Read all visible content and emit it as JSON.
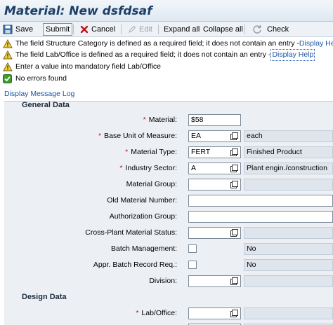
{
  "window": {
    "title": "Material: New dsfdsaf"
  },
  "toolbar": {
    "save_label": "Save",
    "submit_label": "Submit",
    "cancel_label": "Cancel",
    "edit_label": "Edit",
    "expand_all_label": "Expand all",
    "collapse_all_label": "Collapse all",
    "check_label": "Check"
  },
  "messages": [
    {
      "type": "warning",
      "text": "The field Structure Category is defined as a required field; it does not contain an entry - ",
      "link": "Display Help"
    },
    {
      "type": "warning",
      "text": "The field Lab/Office is defined as a required field; it does not contain an entry - ",
      "link": "Display Help"
    },
    {
      "type": "warning",
      "text": "Enter a value into mandatory field Lab/Office",
      "link": ""
    },
    {
      "type": "success",
      "text": "No errors found",
      "link": ""
    }
  ],
  "message_log_link": "Display Message Log",
  "general_data": {
    "title": "General Data",
    "material": {
      "label": "Material:",
      "value": "$58"
    },
    "base_unit": {
      "label": "Base Unit of Measure:",
      "value": "EA",
      "desc": "each"
    },
    "material_type": {
      "label": "Material Type:",
      "value": "FERT",
      "desc": "Finished Product"
    },
    "industry_sector": {
      "label": "Industry Sector:",
      "value": "A",
      "desc": "Plant engin./construction"
    },
    "material_group": {
      "label": "Material Group:",
      "value": "",
      "desc": ""
    },
    "old_material_number": {
      "label": "Old Material Number:",
      "value": ""
    },
    "authorization_group": {
      "label": "Authorization Group:",
      "value": ""
    },
    "cross_plant_status": {
      "label": "Cross-Plant Material Status:",
      "value": "",
      "desc": ""
    },
    "batch_management": {
      "label": "Batch Management:",
      "desc": "No"
    },
    "appr_batch_record": {
      "label": "Appr. Batch Record Req.:",
      "desc": "No"
    },
    "division": {
      "label": "Division:",
      "value": "",
      "desc": ""
    }
  },
  "design_data": {
    "title": "Design Data",
    "lab_office": {
      "label": "Lab/Office:",
      "value": "",
      "desc": ""
    }
  },
  "colors": {
    "title": "#1b3f66",
    "link": "#1a56a8",
    "required": "#c0141a",
    "panel": "#eceff3"
  }
}
